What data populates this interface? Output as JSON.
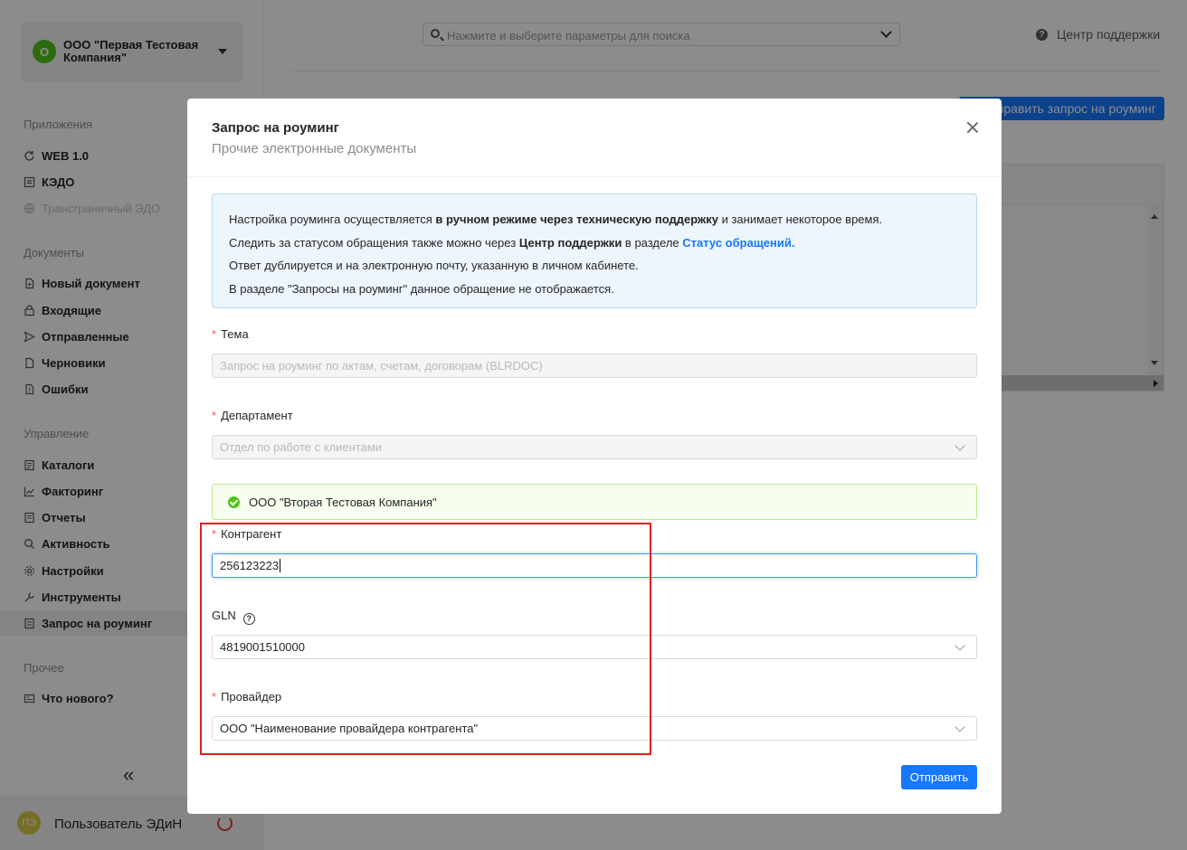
{
  "company": {
    "avatar": "О",
    "name": "ООО \"Первая Тестовая Компания\""
  },
  "sidebar": {
    "sections": [
      {
        "title": "Приложения",
        "items": [
          {
            "label": "WEB 1.0",
            "icon": "refresh-icon"
          },
          {
            "label": "КЭДО",
            "icon": "kedo-icon"
          },
          {
            "label": "Трансграничный ЭДО",
            "icon": "globe-icon"
          }
        ]
      },
      {
        "title": "Документы",
        "items": [
          {
            "label": "Новый документ",
            "icon": "new-doc-icon"
          },
          {
            "label": "Входящие",
            "icon": "inbox-icon"
          },
          {
            "label": "Отправленные",
            "icon": "send-icon"
          },
          {
            "label": "Черновики",
            "icon": "draft-icon"
          },
          {
            "label": "Ошибки",
            "icon": "error-doc-icon"
          }
        ]
      },
      {
        "title": "Управление",
        "items": [
          {
            "label": "Каталоги",
            "icon": "catalog-icon"
          },
          {
            "label": "Факторинг",
            "icon": "chart-icon"
          },
          {
            "label": "Отчеты",
            "icon": "report-icon"
          },
          {
            "label": "Активность",
            "icon": "search-icon"
          },
          {
            "label": "Настройки",
            "icon": "gear-icon"
          },
          {
            "label": "Инструменты",
            "icon": "wrench-icon"
          },
          {
            "label": "Запрос на роуминг",
            "icon": "roaming-icon"
          }
        ]
      },
      {
        "title": "Прочее",
        "items": [
          {
            "label": "Что нового?",
            "icon": "news-icon"
          }
        ]
      }
    ],
    "collapse": "«"
  },
  "user": {
    "avatar": "ПЭ",
    "name": "Пользователь ЭДиН"
  },
  "top": {
    "search_placeholder": "Нажмите и выберите параметры для поиска",
    "support": "Центр поддержки",
    "roaming_button": "Отправить запрос на роуминг"
  },
  "modal": {
    "title": "Запрос на роуминг",
    "subtitle": "Прочие электронные документы",
    "info": {
      "l1_a": "Настройка роуминга осуществляется ",
      "l1_b": "в ручном режиме через техническую поддержку",
      "l1_c": " и занимает некоторое время.",
      "l2_a": "Следить за статусом обращения также можно через ",
      "l2_b": "Центр поддержки",
      "l2_c": " в разделе ",
      "l2_link": "Статус обращений.",
      "l3": "Ответ дублируется и на электронную почту, указанную в личном кабинете.",
      "l4": "В разделе \"Запросы на роуминг\" данное обращение не отображается."
    },
    "topic_label": "Тема",
    "topic_value": "Запрос на роуминг по актам, счетам, договорам (BLRDOC)",
    "department_label": "Департамент",
    "department_value": "Отдел по работе с клиентами",
    "found_company": "ООО \"Вторая Тестовая Компания\"",
    "counterparty_label": "Контрагент",
    "counterparty_value": "256123223",
    "gln_label": "GLN",
    "gln_value": "4819001510000",
    "provider_label": "Провайдер",
    "provider_value": "ООО \"Наименование провайдера контрагента\"",
    "submit": "Отправить"
  }
}
